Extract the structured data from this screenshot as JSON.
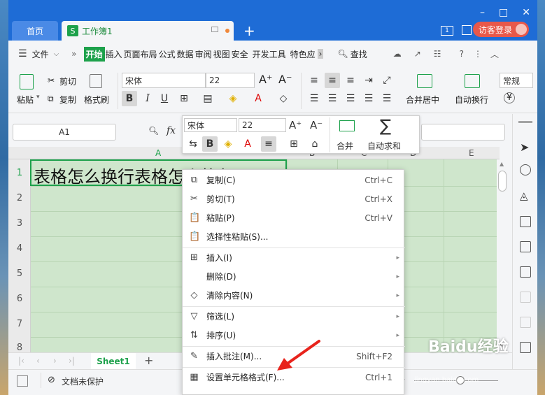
{
  "titlebar": {
    "home_tab": "首页",
    "doc_tab": "工作簿1",
    "doc_icon": "S",
    "new_tab": "+",
    "badge": "1",
    "login": "访客登录",
    "window_buttons": [
      "–",
      "□",
      "✕"
    ]
  },
  "menu": {
    "file": "文件",
    "chevron": "»",
    "items": [
      "开始",
      "插入",
      "页面布局",
      "公式",
      "数据",
      "审阅",
      "视图",
      "安全",
      "开发工具",
      "特色应"
    ],
    "search": "查找"
  },
  "ribbon": {
    "paste": "粘贴",
    "cut": "剪切",
    "copy": "复制",
    "format_painter": "格式刷",
    "font_name": "宋体",
    "font_size": "22",
    "bold": "B",
    "italic": "I",
    "underline": "U",
    "merge_center": "合并居中",
    "wrap_text": "自动换行",
    "number_format": "常规",
    "currency": "¥"
  },
  "formula_bar": {
    "name_box": "A1",
    "fx": "fx"
  },
  "mini_toolbar": {
    "font_name": "宋体",
    "font_size": "22",
    "bold": "B",
    "merge": "合并",
    "autosum": "自动求和",
    "sigma": "∑"
  },
  "sheet": {
    "columns": [
      "A",
      "B",
      "C",
      "D",
      "E"
    ],
    "rows": [
      "1",
      "2",
      "3",
      "4",
      "5",
      "6",
      "7",
      "8"
    ],
    "cell_a1": "表格怎么换行表格怎么换行"
  },
  "context_menu": {
    "items": [
      {
        "icon": "copy-icon",
        "glyph": "⧉",
        "label": "复制(C)",
        "shortcut": "Ctrl+C"
      },
      {
        "icon": "cut-icon",
        "glyph": "✂",
        "label": "剪切(T)",
        "shortcut": "Ctrl+X"
      },
      {
        "icon": "paste-icon",
        "glyph": "📋",
        "label": "粘贴(P)",
        "shortcut": "Ctrl+V"
      },
      {
        "icon": "paste-special-icon",
        "glyph": "📋",
        "label": "选择性粘贴(S)...",
        "shortcut": ""
      },
      {
        "icon": "insert-icon",
        "glyph": "⊞",
        "label": "插入(I)",
        "shortcut": ""
      },
      {
        "icon": "",
        "glyph": "",
        "label": "删除(D)",
        "shortcut": ""
      },
      {
        "icon": "clear-icon",
        "glyph": "◇",
        "label": "清除内容(N)",
        "shortcut": ""
      },
      {
        "icon": "filter-icon",
        "glyph": "▽",
        "label": "筛选(L)",
        "shortcut": ""
      },
      {
        "icon": "sort-icon",
        "glyph": "⇅",
        "label": "排序(U)",
        "shortcut": ""
      },
      {
        "icon": "comment-icon",
        "glyph": "✎",
        "label": "插入批注(M)...",
        "shortcut": "Shift+F2"
      },
      {
        "icon": "format-cells-icon",
        "glyph": "▦",
        "label": "设置单元格格式(F)...",
        "shortcut": "Ctrl+1"
      }
    ]
  },
  "sheet_tabs": {
    "active": "Sheet1",
    "add": "+"
  },
  "status": {
    "protect": "文档未保护"
  },
  "watermark": {
    "brand": "Baidu经验",
    "url": "jingyan.baidu.com"
  },
  "colors": {
    "accent_green": "#1da14b",
    "title_blue": "#1e6cd6",
    "cell_green": "#cfe6cc",
    "arrow_red": "#e8231c"
  }
}
